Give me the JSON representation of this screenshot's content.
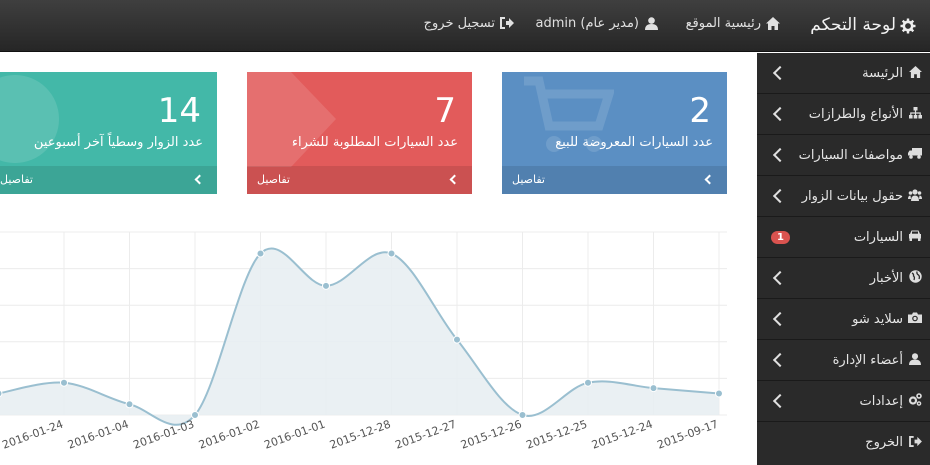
{
  "brand": {
    "title": "لوحة التحكم",
    "icon": "gear-icon"
  },
  "topnav": {
    "home_label": "رئيسية الموقع",
    "user_label": "admin (مدير عام)",
    "logout_label": "تسجيل خروج"
  },
  "sidebar": {
    "items": [
      {
        "label": "الرئيسة",
        "icon": "home-icon"
      },
      {
        "label": "الأنواع والطرازات",
        "icon": "sitemap-icon"
      },
      {
        "label": "مواصفات السيارات",
        "icon": "truck-icon"
      },
      {
        "label": "حقول بيانات الزوار",
        "icon": "users-icon"
      },
      {
        "label": "السيارات",
        "icon": "car-icon",
        "badge": "1"
      },
      {
        "label": "الأخبار",
        "icon": "globe-icon"
      },
      {
        "label": "سلايد شو",
        "icon": "camera-icon"
      },
      {
        "label": "أعضاء الإدارة",
        "icon": "user-icon"
      },
      {
        "label": "إعدادات",
        "icon": "cogs-icon"
      },
      {
        "label": "الخروج",
        "icon": "sign-out-icon"
      }
    ]
  },
  "panels": {
    "cars_for_sale": {
      "number": "2",
      "text": "عدد السيارات المعروضة للبيع",
      "footer": "تفاصيل",
      "color": "#5b8fc3"
    },
    "cars_requested": {
      "number": "7",
      "text": "عدد السيارات المطلوبة للشراء",
      "footer": "تفاصيل",
      "color": "#e25b5b"
    },
    "visitors": {
      "number": "14",
      "text": "عدد الزوار وسطياً آخر أسبوعين",
      "footer": "تفاصيل",
      "color": "#43b8a8"
    }
  },
  "chart_data": {
    "type": "area",
    "categories": [
      "2016-01-24",
      "2016-01-04",
      "2016-01-03",
      "2016-01-02",
      "2016-01-01",
      "2015-12-28",
      "2015-12-27",
      "2015-12-26",
      "2015-12-25",
      "2015-12-24",
      "2015-09-17"
    ],
    "values": [
      3,
      1,
      0,
      15,
      12,
      15,
      7,
      0,
      3,
      2.5,
      2
    ],
    "leading_value": 2,
    "ylim": [
      0,
      17
    ],
    "grid": true,
    "line_color": "#9abfd0",
    "fill_color": "#e8eef2",
    "point_color": "#9abfd0"
  }
}
